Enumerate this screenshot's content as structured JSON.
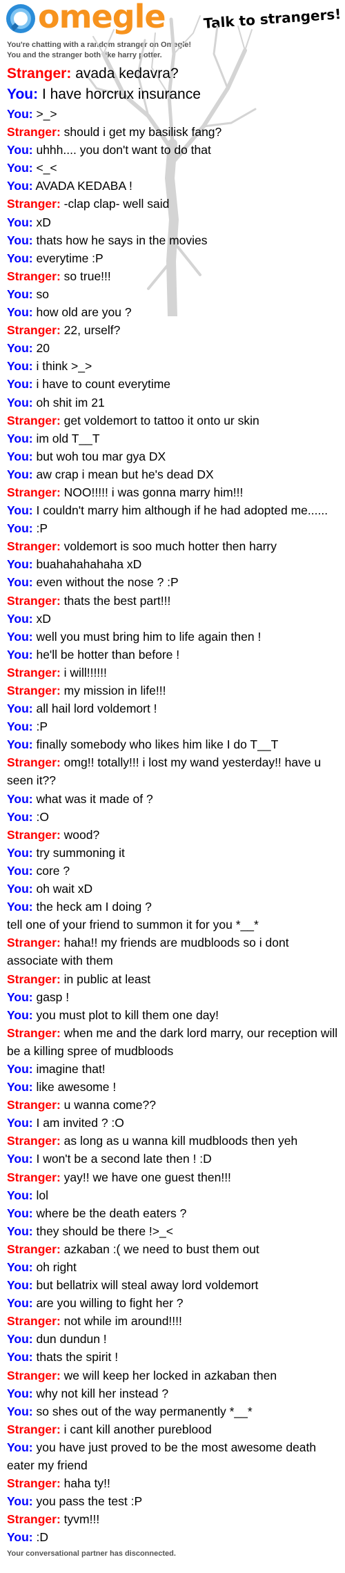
{
  "brand": {
    "name": "omegle",
    "tagline": "Talk to strangers!"
  },
  "intro": {
    "line1": "You're chatting with a random stranger on Omegle!",
    "line2": "You and the stranger both like harry potter."
  },
  "colors": {
    "you": "#0000ff",
    "stranger": "#ff0000",
    "brand_orange": "#f7931e",
    "brand_blue": "#2a8cd8"
  },
  "messages": [
    {
      "sender": "Stranger",
      "label": "Stranger:",
      "text": "avada kedavra?"
    },
    {
      "sender": "You",
      "label": "You:",
      "text": "I have horcrux insurance"
    },
    {
      "sender": "You",
      "label": "You:",
      "text": ">_>"
    },
    {
      "sender": "Stranger",
      "label": "Stranger:",
      "text": "should i get my basilisk fang?"
    },
    {
      "sender": "You",
      "label": "You:",
      "text": "uhhh.... you don't want to do that"
    },
    {
      "sender": "You",
      "label": "You:",
      "text": "<_<"
    },
    {
      "sender": "You",
      "label": "You:",
      "text": "AVADA KEDABA !"
    },
    {
      "sender": "Stranger",
      "label": "Stranger:",
      "text": "-clap clap- well said"
    },
    {
      "sender": "You",
      "label": "You:",
      "text": "xD"
    },
    {
      "sender": "You",
      "label": "You:",
      "text": "thats how he says in the movies"
    },
    {
      "sender": "You",
      "label": "You:",
      "text": "everytime :P"
    },
    {
      "sender": "Stranger",
      "label": "Stranger:",
      "text": "so true!!!"
    },
    {
      "sender": "You",
      "label": "You:",
      "text": "so"
    },
    {
      "sender": "You",
      "label": "You:",
      "text": "how old are you ?"
    },
    {
      "sender": "Stranger",
      "label": "Stranger:",
      "text": "22, urself?"
    },
    {
      "sender": "You",
      "label": "You:",
      "text": "20"
    },
    {
      "sender": "You",
      "label": "You:",
      "text": "i think >_>"
    },
    {
      "sender": "You",
      "label": "You:",
      "text": "i have to count everytime"
    },
    {
      "sender": "You",
      "label": "You:",
      "text": "oh shit im 21"
    },
    {
      "sender": "Stranger",
      "label": "Stranger:",
      "text": "get voldemort to tattoo it onto ur skin"
    },
    {
      "sender": "You",
      "label": "You:",
      "text": "im old T__T"
    },
    {
      "sender": "You",
      "label": "You:",
      "text": "but woh tou mar gya DX"
    },
    {
      "sender": "You",
      "label": "You:",
      "text": "aw crap i mean but he's dead DX"
    },
    {
      "sender": "Stranger",
      "label": "Stranger:",
      "text": "NOO!!!!! i was gonna marry him!!!"
    },
    {
      "sender": "You",
      "label": "You:",
      "text": "I couldn't marry him although if he had adopted me......"
    },
    {
      "sender": "You",
      "label": "You:",
      "text": ":P"
    },
    {
      "sender": "Stranger",
      "label": "Stranger:",
      "text": "voldemort is soo much hotter then harry"
    },
    {
      "sender": "You",
      "label": "You:",
      "text": "buahahahahaha xD"
    },
    {
      "sender": "You",
      "label": "You:",
      "text": "even without the nose ? :P"
    },
    {
      "sender": "Stranger",
      "label": "Stranger:",
      "text": "thats the best part!!!"
    },
    {
      "sender": "You",
      "label": "You:",
      "text": "xD"
    },
    {
      "sender": "You",
      "label": "You:",
      "text": "well you must bring him to life again then !"
    },
    {
      "sender": "You",
      "label": "You:",
      "text": "he'll be hotter than before !"
    },
    {
      "sender": "Stranger",
      "label": "Stranger:",
      "text": "i will!!!!!!"
    },
    {
      "sender": "Stranger",
      "label": "Stranger:",
      "text": "my mission in life!!!"
    },
    {
      "sender": "You",
      "label": "You:",
      "text": "all hail lord voldemort !"
    },
    {
      "sender": "You",
      "label": "You:",
      "text": ":P"
    },
    {
      "sender": "You",
      "label": "You:",
      "text": "finally somebody who likes him like I do T__T"
    },
    {
      "sender": "Stranger",
      "label": "Stranger:",
      "text": "omg!! totally!!! i lost my wand yesterday!! have u seen it??"
    },
    {
      "sender": "You",
      "label": "You:",
      "text": "what was it made of ?"
    },
    {
      "sender": "You",
      "label": "You:",
      "text": ":O"
    },
    {
      "sender": "Stranger",
      "label": "Stranger:",
      "text": "wood?"
    },
    {
      "sender": "You",
      "label": "You:",
      "text": "try summoning it"
    },
    {
      "sender": "You",
      "label": "You:",
      "text": "core ?"
    },
    {
      "sender": "You",
      "label": "You:",
      "text": "oh wait xD"
    },
    {
      "sender": "You",
      "label": "You:",
      "text": "the heck am I doing ?"
    },
    {
      "sender": "",
      "label": "",
      "text": "tell one of your friend to summon it for you *__*"
    },
    {
      "sender": "Stranger",
      "label": "Stranger:",
      "text": "haha!! my friends are mudbloods so i dont associate with them"
    },
    {
      "sender": "Stranger",
      "label": "Stranger:",
      "text": "in public at least"
    },
    {
      "sender": "You",
      "label": "You:",
      "text": "gasp !"
    },
    {
      "sender": "You",
      "label": "You:",
      "text": "you must plot to kill them one day!"
    },
    {
      "sender": "Stranger",
      "label": "Stranger:",
      "text": "when me and the dark lord marry, our reception will be a killing spree of mudbloods"
    },
    {
      "sender": "You",
      "label": "You:",
      "text": "imagine that!"
    },
    {
      "sender": "You",
      "label": "You:",
      "text": "like awesome !"
    },
    {
      "sender": "Stranger",
      "label": "Stranger:",
      "text": "u wanna come??"
    },
    {
      "sender": "You",
      "label": "You:",
      "text": "I am invited ? :O"
    },
    {
      "sender": "Stranger",
      "label": "Stranger:",
      "text": "as long as u wanna kill mudbloods then yeh"
    },
    {
      "sender": "You",
      "label": "You:",
      "text": "I won't be a second late then ! :D"
    },
    {
      "sender": "Stranger",
      "label": "Stranger:",
      "text": "yay!! we have one guest then!!!"
    },
    {
      "sender": "You",
      "label": "You:",
      "text": "lol"
    },
    {
      "sender": "You",
      "label": "You:",
      "text": "where be the death eaters ?"
    },
    {
      "sender": "You",
      "label": "You:",
      "text": "they should be there !>_<"
    },
    {
      "sender": "Stranger",
      "label": "Stranger:",
      "text": "azkaban :( we need to bust them out"
    },
    {
      "sender": "You",
      "label": "You:",
      "text": "oh right"
    },
    {
      "sender": "You",
      "label": "You:",
      "text": "but bellatrix will steal away lord voldemort"
    },
    {
      "sender": "You",
      "label": "You:",
      "text": "are you willing to fight her ?"
    },
    {
      "sender": "Stranger",
      "label": "Stranger:",
      "text": "not while im around!!!!"
    },
    {
      "sender": "You",
      "label": "You:",
      "text": "dun dundun !"
    },
    {
      "sender": "You",
      "label": "You:",
      "text": "thats the spirit !"
    },
    {
      "sender": "Stranger",
      "label": "Stranger:",
      "text": "we will keep her locked in azkaban then"
    },
    {
      "sender": "You",
      "label": "You:",
      "text": "why not kill her instead ?"
    },
    {
      "sender": "You",
      "label": "You:",
      "text": "so shes out of the way permanently *__*"
    },
    {
      "sender": "Stranger",
      "label": "Stranger:",
      "text": "i cant kill another pureblood"
    },
    {
      "sender": "You",
      "label": "You:",
      "text": "you have just proved to be the most awesome death eater my friend"
    },
    {
      "sender": "Stranger",
      "label": "Stranger:",
      "text": "haha ty!!"
    },
    {
      "sender": "You",
      "label": "You:",
      "text": "you pass the test :P"
    },
    {
      "sender": "Stranger",
      "label": "Stranger:",
      "text": "tyvm!!!"
    },
    {
      "sender": "You",
      "label": "You:",
      "text": ":D"
    }
  ],
  "status": "Your conversational partner has disconnected."
}
